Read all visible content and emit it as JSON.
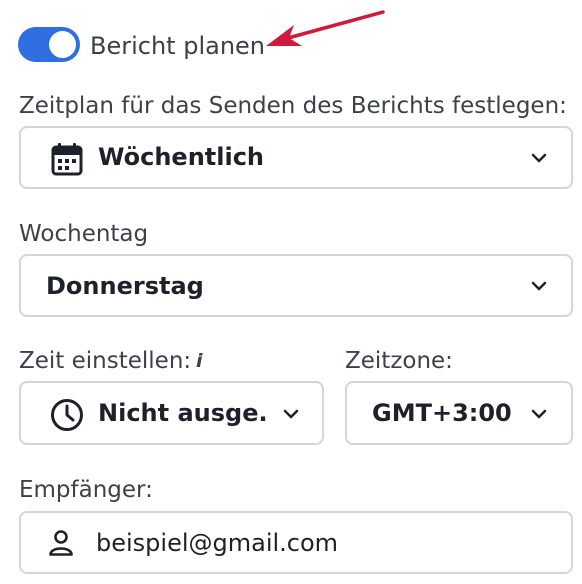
{
  "schedule_toggle": {
    "label": "Bericht planen",
    "enabled": true
  },
  "frequency": {
    "label": "Zeitplan für das Senden des Berichts festlegen:",
    "value": "Wöchentlich",
    "icon": "calendar-icon"
  },
  "weekday": {
    "label": "Wochentag",
    "value": "Donnerstag"
  },
  "time": {
    "label": "Zeit einstellen:",
    "info_glyph": "i",
    "value": "Nicht ausge...",
    "icon": "clock-icon"
  },
  "timezone": {
    "label": "Zeitzone:",
    "value": "GMT+3:00"
  },
  "recipients": {
    "label": "Empfänger:",
    "value": "beispiel@gmail.com",
    "icon": "person-icon"
  },
  "colors": {
    "toggle_on": "#2f6fe0",
    "arrow": "#d01a3c",
    "border": "#d3d4dc"
  }
}
